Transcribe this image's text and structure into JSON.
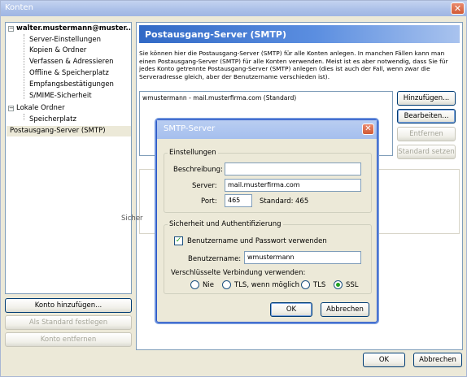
{
  "window": {
    "title": "Konten"
  },
  "tree": {
    "account": "walter.mustermann@muster...",
    "account_items": [
      "Server-Einstellungen",
      "Kopien & Ordner",
      "Verfassen & Adressieren",
      "Offline & Speicherplatz",
      "Empfangsbestätigungen",
      "S/MIME-Sicherheit"
    ],
    "local": "Lokale Ordner",
    "local_items": [
      "Speicherplatz"
    ],
    "smtp": "Postausgang-Server (SMTP)"
  },
  "left_buttons": {
    "add_account": "Konto hinzufügen...",
    "set_default": "Als Standard festlegen",
    "remove_account": "Konto entfernen"
  },
  "panel": {
    "title": "Postausgang-Server (SMTP)",
    "description": "Sie können hier die Postausgang-Server (SMTP) für alle Konten anlegen. In manchen Fällen kann man einen Postausgang-Server (SMTP) für alle Konten verwenden. Meist ist es aber notwendig, dass Sie für jedes Konto getrennte Postausgang-Server (SMTP) anlegen (dies ist auch der Fall, wenn zwar die Serveradresse gleich, aber der Benutzername verschieden ist).",
    "server_entry": "wmustermann - mail.musterfirma.com (Standard)",
    "buttons": {
      "add": "Hinzufügen...",
      "edit": "Bearbeiten...",
      "remove": "Entfernen",
      "default": "Standard setzen"
    },
    "details_clip": "Sicher"
  },
  "dialog": {
    "title": "SMTP-Server",
    "settings_group": "Einstellungen",
    "description_label": "Beschreibung:",
    "description_value": "",
    "server_label": "Server:",
    "server_value": "mail.musterfirma.com",
    "port_label": "Port:",
    "port_value": "465",
    "standard_label": "Standard:",
    "standard_value": "465",
    "security_group": "Sicherheit und Authentifizierung",
    "use_auth": "Benutzername und Passwort verwenden",
    "username_label": "Benutzername:",
    "username_value": "wmustermann",
    "encryption_label": "Verschlüsselte Verbindung verwenden:",
    "radio_no": "Nie",
    "radio_tls_possible": "TLS, wenn möglich",
    "radio_tls": "TLS",
    "radio_ssl": "SSL",
    "ok": "OK",
    "cancel": "Abbrechen"
  },
  "bottom": {
    "ok": "OK",
    "cancel": "Abbrechen"
  },
  "colors": {
    "accent": "#3169c6",
    "titlebar": "#aabfe8",
    "checkmark": "#21a121"
  }
}
